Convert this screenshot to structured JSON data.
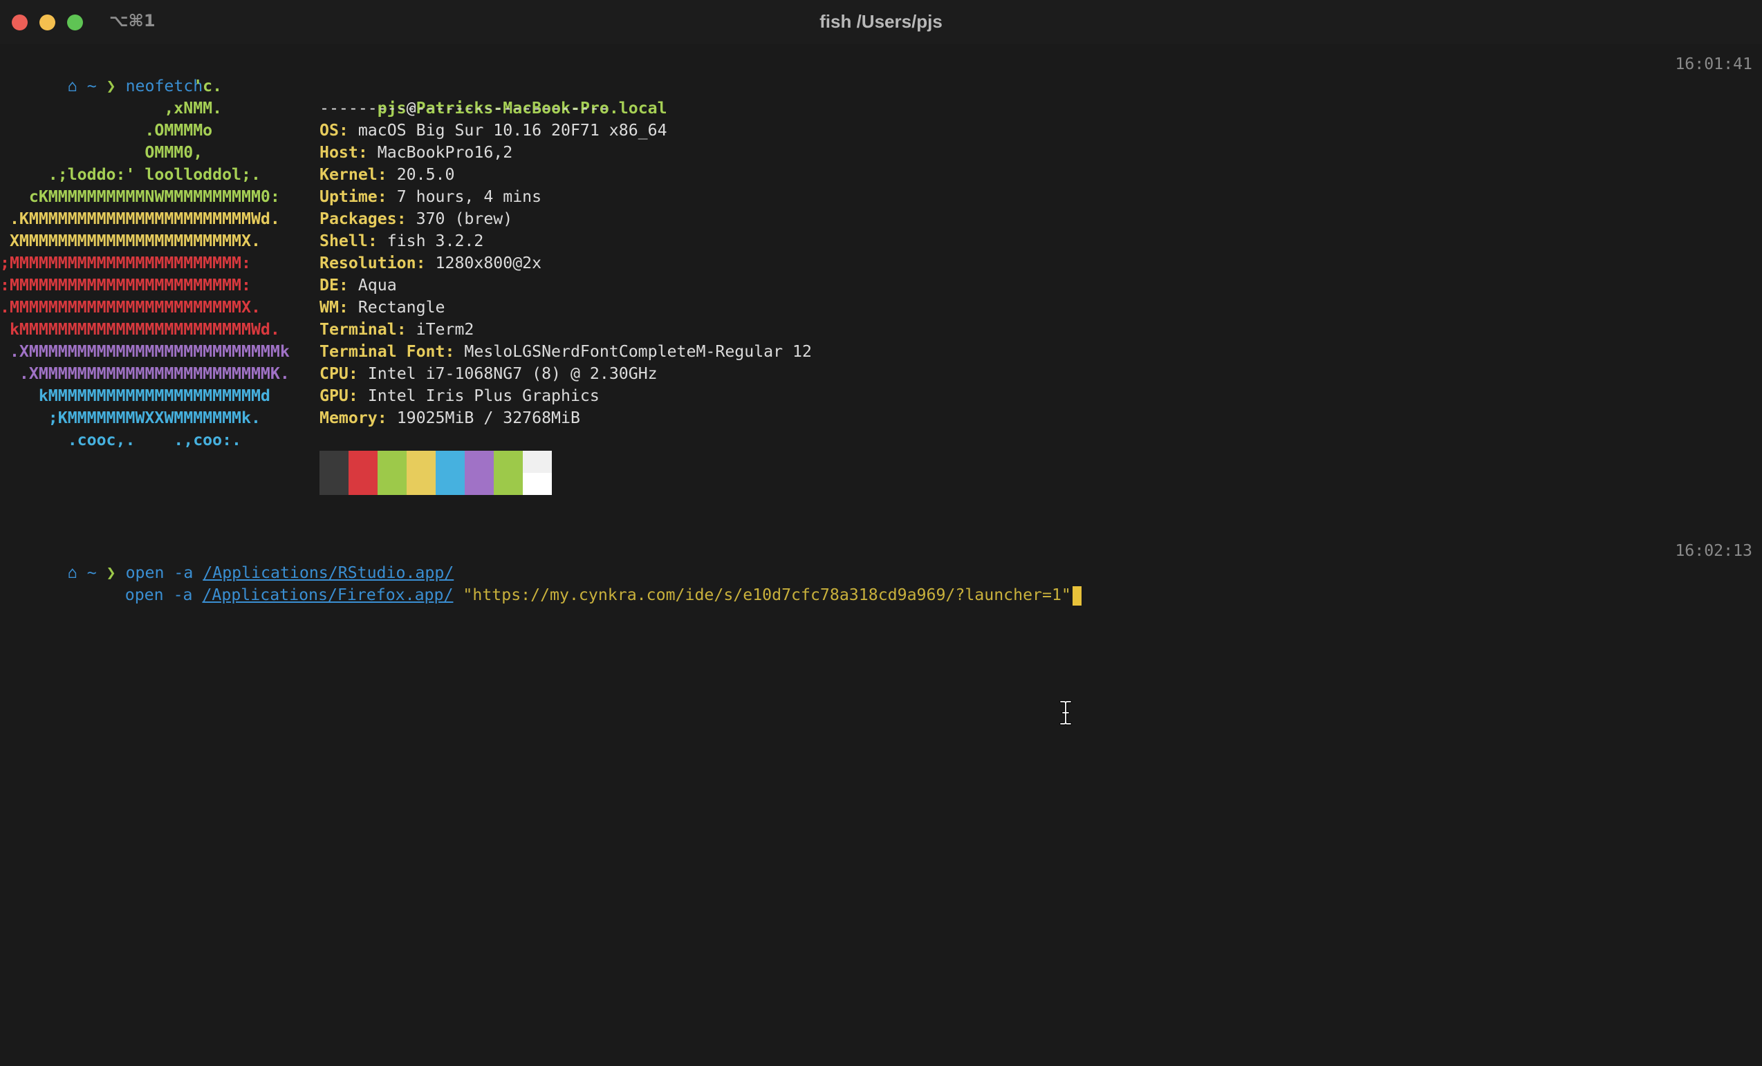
{
  "window": {
    "title": "fish /Users/pjs",
    "shortcut": "⌥⌘1",
    "traffic_lights": {
      "close": "#ec5f57",
      "minimize": "#f4bf4f",
      "maximize": "#5fc454"
    }
  },
  "colors": {
    "background": "#1a1a1a",
    "prompt_blue": "#3a8fd3",
    "prompt_green": "#9dc94a",
    "label_yellow": "#e7cc5c",
    "string_yellow": "#c9b13c",
    "cursor": "#e8c23a"
  },
  "session": [
    {
      "prompt_icon": "home-icon",
      "prompt_glyph": "⌂",
      "cwd": "~",
      "chevron": "❯",
      "command": "neofetch",
      "timestamp": "16:01:41"
    },
    {
      "prompt_icon": "home-icon",
      "prompt_glyph": "⌂",
      "cwd": "~",
      "chevron": "❯",
      "command_line1": {
        "cmd": "open",
        "flag": "-a",
        "path": "/Applications/RStudio.app/"
      },
      "command_line2": {
        "cmd": "open",
        "flag": "-a",
        "path": "/Applications/Firefox.app/",
        "arg": "\"https://my.cynkra.com/ide/s/e10d7cfc78a318cd9a969/?launcher=1\""
      },
      "timestamp": "16:02:13"
    }
  ],
  "neofetch": {
    "ascii_logo": [
      {
        "text": "                    'c.",
        "color": "#a6d055"
      },
      {
        "text": "                 ,xNMM.",
        "color": "#a6d055"
      },
      {
        "text": "               .OMMMMo",
        "color": "#a6d055"
      },
      {
        "text": "               OMMM0,",
        "color": "#a6d055"
      },
      {
        "text": "     .;loddo:' loolloddol;.",
        "color": "#a6d055"
      },
      {
        "text": "   cKMMMMMMMMMMNWMMMMMMMMMM0:",
        "color": "#a6d055"
      },
      {
        "text": " .KMMMMMMMMMMMMMMMMMMMMMMMWd.",
        "color": "#e7cc5c"
      },
      {
        "text": " XMMMMMMMMMMMMMMMMMMMMMMMX.",
        "color": "#e7cc5c"
      },
      {
        "text": ";MMMMMMMMMMMMMMMMMMMMMMMM:",
        "color": "#d9393e"
      },
      {
        "text": ":MMMMMMMMMMMMMMMMMMMMMMMM:",
        "color": "#d9393e"
      },
      {
        "text": ".MMMMMMMMMMMMMMMMMMMMMMMMX.",
        "color": "#d9393e"
      },
      {
        "text": " kMMMMMMMMMMMMMMMMMMMMMMMMWd.",
        "color": "#d9393e"
      },
      {
        "text": " .XMMMMMMMMMMMMMMMMMMMMMMMMMMk",
        "color": "#a072c6"
      },
      {
        "text": "  .XMMMMMMMMMMMMMMMMMMMMMMMMK.",
        "color": "#a072c6"
      },
      {
        "text": "    kMMMMMMMMMMMMMMMMMMMMMMd",
        "color": "#46b1df"
      },
      {
        "text": "     ;KMMMMMMMWXXWMMMMMMMk.",
        "color": "#46b1df"
      },
      {
        "text": "       .cooc,.    .,coo:.",
        "color": "#46b1df"
      }
    ],
    "user": "pjs",
    "at": "@",
    "host": "Patricks-MacBook-Pro.local",
    "separator": "------------------------------",
    "info": [
      {
        "label": "OS",
        "value": "macOS Big Sur 10.16 20F71 x86_64"
      },
      {
        "label": "Host",
        "value": "MacBookPro16,2"
      },
      {
        "label": "Kernel",
        "value": "20.5.0"
      },
      {
        "label": "Uptime",
        "value": "7 hours, 4 mins"
      },
      {
        "label": "Packages",
        "value": "370 (brew)"
      },
      {
        "label": "Shell",
        "value": "fish 3.2.2"
      },
      {
        "label": "Resolution",
        "value": "1280x800@2x"
      },
      {
        "label": "DE",
        "value": "Aqua"
      },
      {
        "label": "WM",
        "value": "Rectangle"
      },
      {
        "label": "Terminal",
        "value": "iTerm2"
      },
      {
        "label": "Terminal Font",
        "value": "MesloLGSNerdFontCompleteM-Regular 12"
      },
      {
        "label": "CPU",
        "value": "Intel i7-1068NG7 (8) @ 2.30GHz"
      },
      {
        "label": "GPU",
        "value": "Intel Iris Plus Graphics"
      },
      {
        "label": "Memory",
        "value": "19025MiB / 32768MiB"
      }
    ],
    "color_blocks": [
      {
        "top": "#3a3a3a",
        "bottom": "#3a3a3a"
      },
      {
        "top": "#d9393e",
        "bottom": "#d9393e"
      },
      {
        "top": "#9dc94a",
        "bottom": "#9dc94a"
      },
      {
        "top": "#e7cc5c",
        "bottom": "#e7cc5c"
      },
      {
        "top": "#46b1df",
        "bottom": "#46b1df"
      },
      {
        "top": "#a072c6",
        "bottom": "#a072c6"
      },
      {
        "top": "#9dc94a",
        "bottom": "#9dc94a"
      },
      {
        "top": "#f0f0f0",
        "bottom": "#ffffff"
      }
    ]
  },
  "mouse_cursor": "text-ibeam-icon"
}
